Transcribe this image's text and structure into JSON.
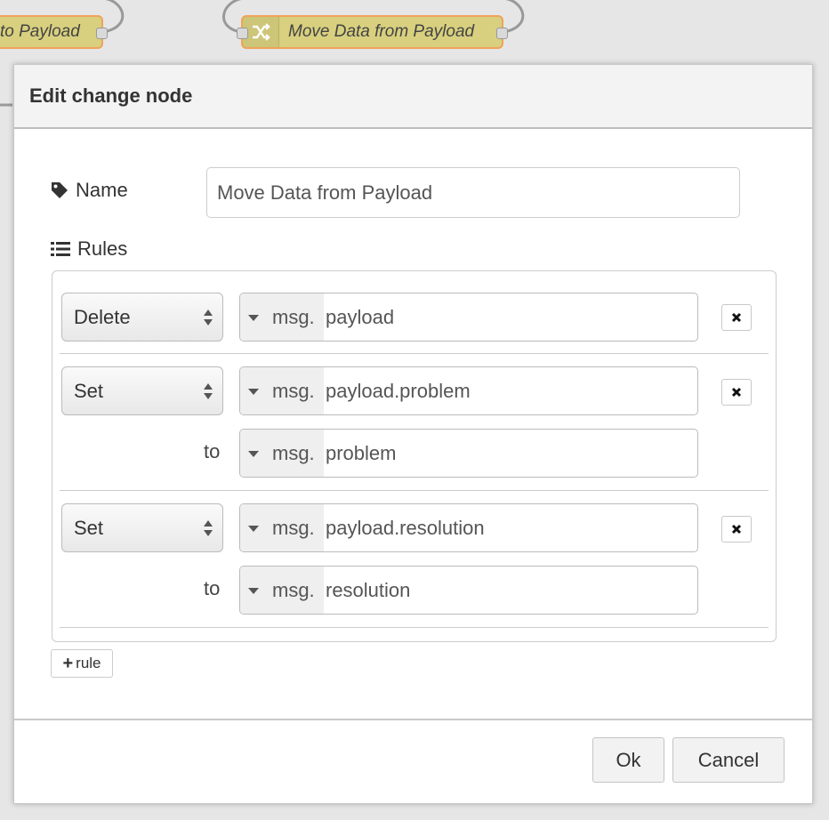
{
  "workspace": {
    "nodes": [
      {
        "label": "to Payload"
      },
      {
        "label": "Move Data from Payload",
        "icon": "shuffle-icon"
      }
    ]
  },
  "dialog": {
    "title": "Edit change node",
    "name_label": "Name",
    "name_value": "Move Data from Payload",
    "rules_label": "Rules",
    "rules": [
      {
        "action": "Delete",
        "prefix": "msg.",
        "property": "payload"
      },
      {
        "action": "Set",
        "prefix": "msg.",
        "property": "payload.problem",
        "to_label": "to",
        "to_prefix": "msg.",
        "to_value": "problem"
      },
      {
        "action": "Set",
        "prefix": "msg.",
        "property": "payload.resolution",
        "to_label": "to",
        "to_prefix": "msg.",
        "to_value": "resolution"
      }
    ],
    "add_rule_label": "rule",
    "ok_label": "Ok",
    "cancel_label": "Cancel"
  },
  "colors": {
    "node_fill": "#d8d07e",
    "node_border": "#f0a35a"
  }
}
